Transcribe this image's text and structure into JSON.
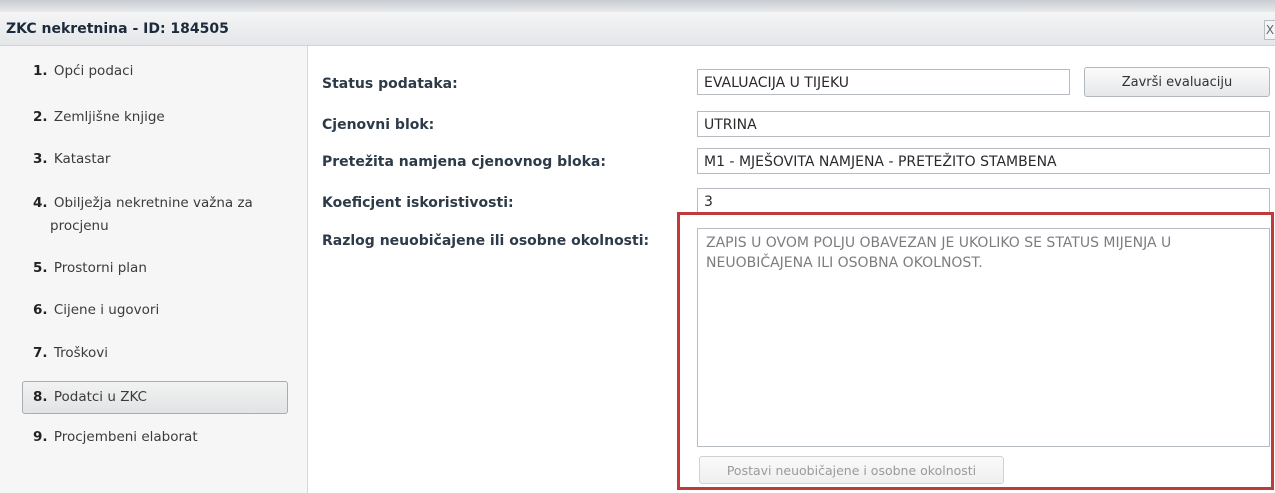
{
  "window": {
    "title": "ZKC nekretnina - ID: 184505",
    "close_label": "X"
  },
  "sidebar": {
    "items": [
      {
        "num": "1.",
        "label": "Opći podaci"
      },
      {
        "num": "2.",
        "label": "Zemljišne knjige"
      },
      {
        "num": "3.",
        "label": "Katastar"
      },
      {
        "num": "4.",
        "label": "Obilježja nekretnine važna za",
        "label2": "procjenu"
      },
      {
        "num": "5.",
        "label": "Prostorni plan"
      },
      {
        "num": "6.",
        "label": "Cijene i ugovori"
      },
      {
        "num": "7.",
        "label": "Troškovi"
      },
      {
        "num": "8.",
        "label": "Podatci u ZKC",
        "selected": true
      },
      {
        "num": "9.",
        "label": "Procjembeni elaborat"
      }
    ]
  },
  "form": {
    "status": {
      "label": "Status podataka:",
      "value": "EVALUACIJA U TIJEKU"
    },
    "finish_button": "Završi evaluaciju",
    "price_block": {
      "label": "Cjenovni blok:",
      "value": "UTRINA"
    },
    "purpose": {
      "label": "Pretežita namjena cjenovnog bloka:",
      "value": "M1 - MJEŠOVITA NAMJENA - PRETEŽITO STAMBENA"
    },
    "coefficient": {
      "label": "Koeficjent iskoristivosti:",
      "value": "3"
    },
    "reason": {
      "label": "Razlog neuobičajene ili osobne okolnosti:",
      "placeholder": "ZAPIS U OVOM POLJU OBAVEZAN JE UKOLIKO SE STATUS MIJENJA U NEUOBIČAJENA ILI OSOBNA OKOLNOST."
    },
    "set_button": "Postavi neuobičajene i osobne okolnosti"
  },
  "colors": {
    "highlight": "#c0393b"
  }
}
